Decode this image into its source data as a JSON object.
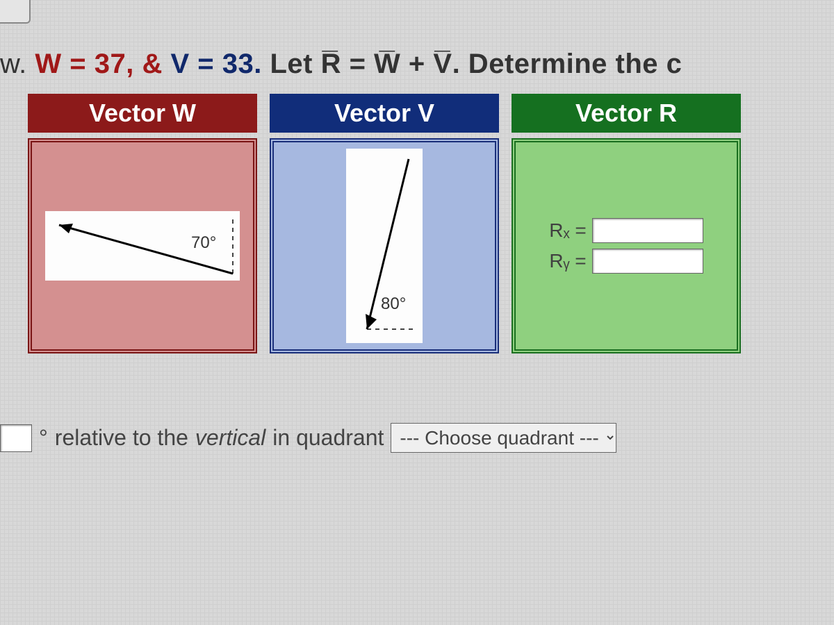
{
  "problem": {
    "prefix": "w. ",
    "w_text": "W = 37,",
    "amp": " & ",
    "v_text": "V = 33.",
    "rest": " Let R̅ = W̅ + V̅. Determine the c"
  },
  "headers": {
    "w": "Vector W",
    "v": "Vector V",
    "r": "Vector R"
  },
  "angles": {
    "w": "70°",
    "v": "80°"
  },
  "resultant": {
    "rx_label": "Rₓ =",
    "ry_label": "Rᵧ =",
    "rx_value": "",
    "ry_value": ""
  },
  "bottom": {
    "degree_sym": "°",
    "text1": " relative to the ",
    "vertical": "vertical",
    "text2": " in quadrant ",
    "select_placeholder": "--- Choose quadrant ---"
  }
}
